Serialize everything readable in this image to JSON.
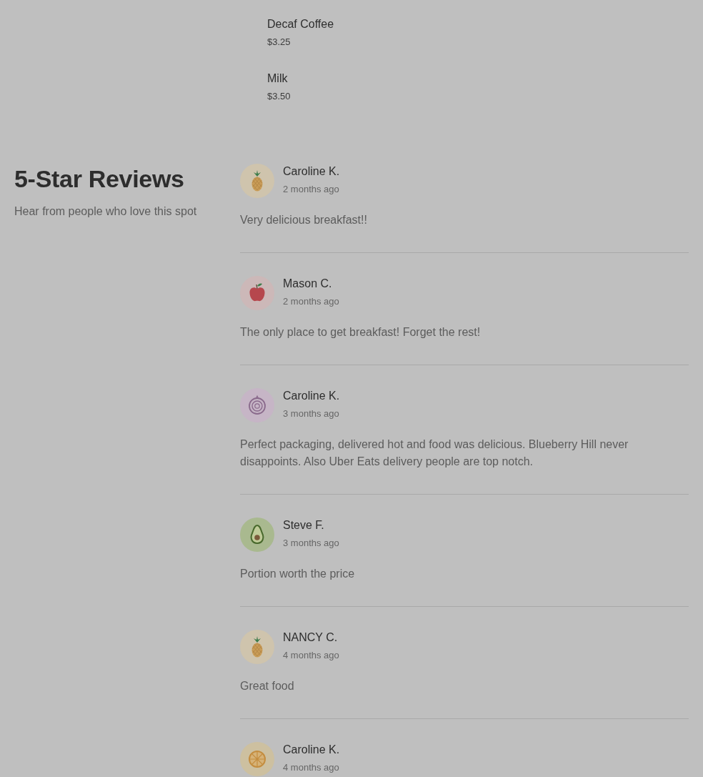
{
  "menu_items": [
    {
      "name": "Decaf Coffee",
      "price": "$3.25"
    },
    {
      "name": "Milk",
      "price": "$3.50"
    }
  ],
  "reviews_section": {
    "title": "5-Star Reviews",
    "subtitle": "Hear from people who love this spot",
    "reviews": [
      {
        "author": "Caroline K.",
        "time": "2 months ago",
        "text": "Very delicious breakfast!!"
      },
      {
        "author": "Mason C.",
        "time": "2 months ago",
        "text": "The only place to get breakfast! Forget the rest!"
      },
      {
        "author": "Caroline K.",
        "time": "3 months ago",
        "text": "Perfect packaging, delivered hot and food was delicious. Blueberry Hill never disappoints. Also Uber Eats delivery people are top notch."
      },
      {
        "author": "Steve F.",
        "time": "3 months ago",
        "text": "Portion worth the price"
      },
      {
        "author": "NANCY C.",
        "time": "4 months ago",
        "text": "Great food"
      },
      {
        "author": "Caroline K.",
        "time": "4 months ago"
      }
    ]
  }
}
